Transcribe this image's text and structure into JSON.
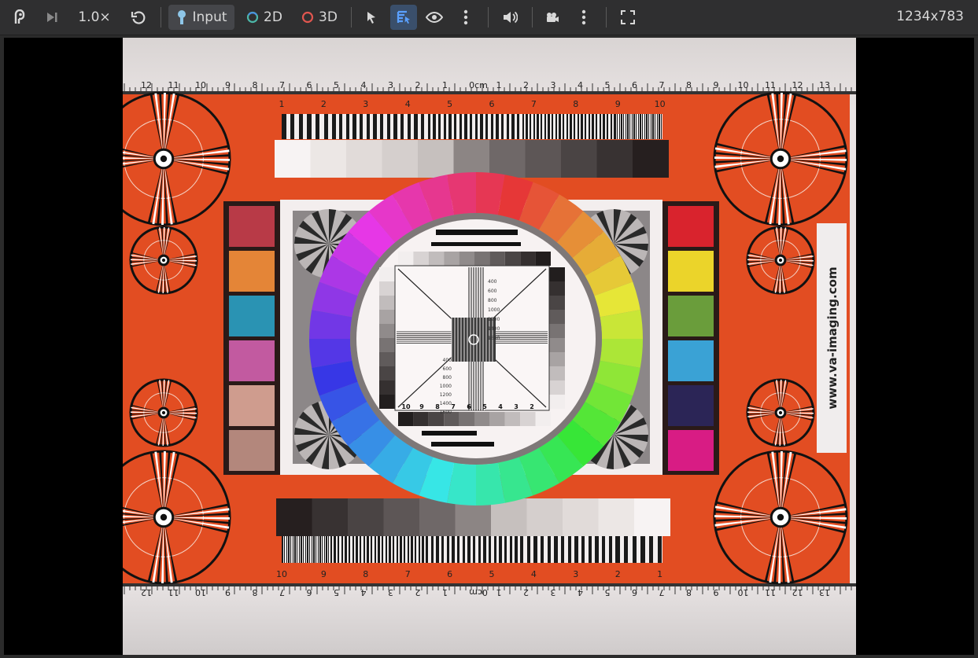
{
  "toolbar": {
    "speed_label": "1.0×",
    "input_label": "Input",
    "mode_2d_label": "2D",
    "mode_3d_label": "3D",
    "resolution": "1234x783"
  },
  "colors": {
    "toolbar_bg": "#2f2f30",
    "active_bg": "#3a4f6b",
    "accent_blue": "#5aa0ff",
    "dot_2d": "#3aa7d9",
    "dot_3d": "#e0564f"
  },
  "chart": {
    "website": "www.va-imaging.com",
    "top_ruler_left": [
      "12",
      "11",
      "10",
      "9",
      "8",
      "7",
      "6",
      "5",
      "4",
      "3",
      "2",
      "1"
    ],
    "top_ruler_center": "0cm",
    "top_ruler_right": [
      "1",
      "2",
      "3",
      "4",
      "5",
      "6",
      "7",
      "8",
      "9",
      "10",
      "11",
      "12",
      "13"
    ],
    "bar_scale": [
      "1",
      "2",
      "3",
      "4",
      "5",
      "6",
      "7",
      "8",
      "9",
      "10"
    ],
    "bottom_bar_scale": [
      "10",
      "9",
      "8",
      "7",
      "6",
      "5",
      "4",
      "3",
      "2",
      "1"
    ],
    "inner_scale": [
      "10",
      "9",
      "8",
      "7",
      "6",
      "5",
      "4",
      "3",
      "2"
    ],
    "res_values": [
      "400",
      "600",
      "800",
      "1000",
      "1200",
      "1400",
      "1600"
    ]
  }
}
